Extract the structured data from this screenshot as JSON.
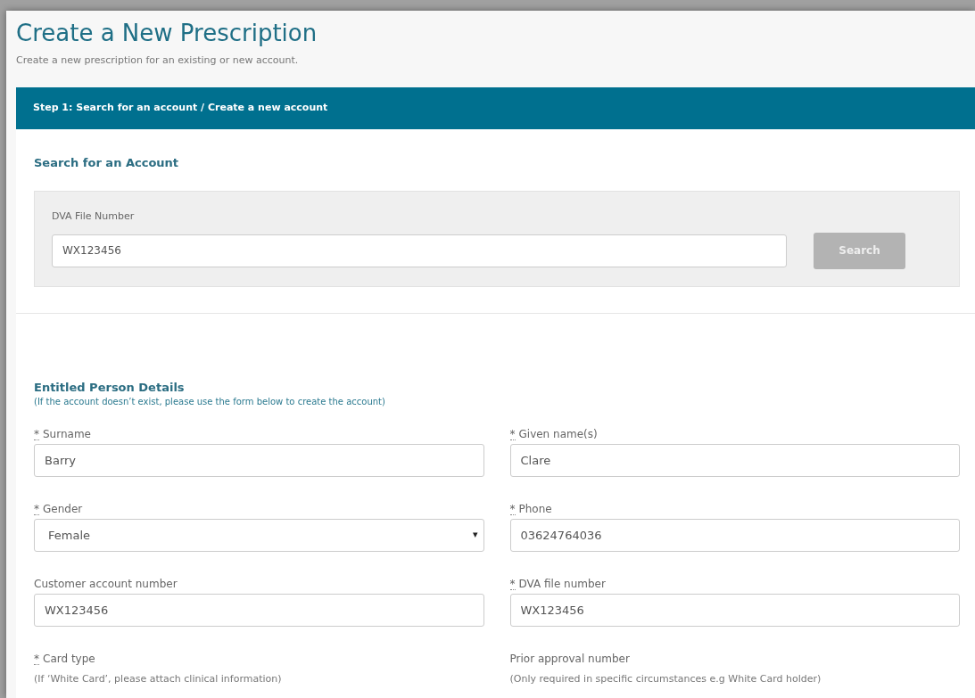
{
  "page": {
    "title": "Create a New Prescription",
    "subtitle": "Create a new prescription for an existing or new account."
  },
  "step": {
    "title": "Step 1: Search for an account / Create a new account"
  },
  "search": {
    "heading": "Search for an Account",
    "label": "DVA File Number",
    "value": "WX123456",
    "button": {
      "label": "Search",
      "disabled": true
    }
  },
  "details": {
    "heading": "Entitled Person Details",
    "note": "(If the account doesn’t exist, please use the form below to create the account)",
    "fields": [
      {
        "kind": "input",
        "asterisk": "*",
        "label": "Surname",
        "value": "Barry"
      },
      {
        "kind": "input",
        "asterisk": "*",
        "label": "Given name(s)",
        "value": "Clare"
      },
      {
        "kind": "select",
        "asterisk": "*",
        "label": "Gender",
        "value": "Female",
        "caret": "▾"
      },
      {
        "kind": "input",
        "asterisk": "*",
        "label": "Phone",
        "value": "03624764036"
      },
      {
        "kind": "input",
        "label": "Customer account number",
        "value": "WX123456"
      },
      {
        "kind": "input",
        "asterisk": "*",
        "label": "DVA file number",
        "value": "WX123456"
      },
      {
        "kind": "hint",
        "asterisk": "*",
        "label": "Card type",
        "hint": "(If ‘White Card’, please attach clinical information)"
      },
      {
        "kind": "hint",
        "label": "Prior approval number",
        "hint": "(Only required in specific circumstances e.g White Card holder)"
      }
    ]
  }
}
